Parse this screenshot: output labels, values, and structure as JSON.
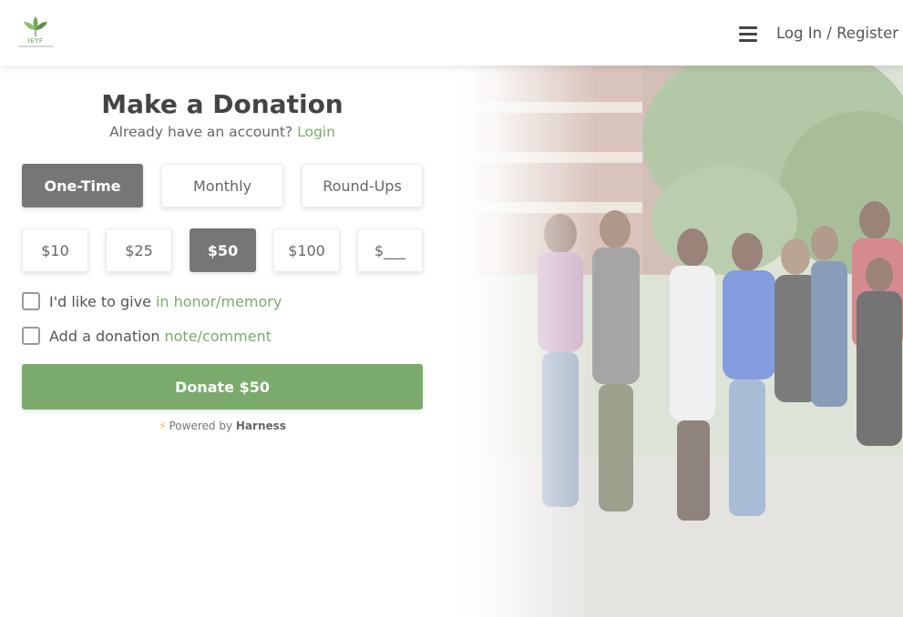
{
  "header": {
    "logo_text": "IEYF",
    "menu_icon": "hamburger-icon",
    "login_register": "Log In / Register"
  },
  "donation": {
    "title": "Make a Donation",
    "account_prompt": "Already have an account?",
    "login_link": "Login",
    "frequency": [
      {
        "label": "One-Time",
        "selected": true
      },
      {
        "label": "Monthly",
        "selected": false
      },
      {
        "label": "Round-Ups",
        "selected": false
      }
    ],
    "amounts": [
      {
        "label": "$10",
        "selected": false
      },
      {
        "label": "$25",
        "selected": false
      },
      {
        "label": "$50",
        "selected": true
      },
      {
        "label": "$100",
        "selected": false
      },
      {
        "label": "$___",
        "selected": false
      }
    ],
    "honor": {
      "prefix": "I'd like to give",
      "link": "in honor/memory",
      "checked": false
    },
    "note": {
      "prefix": "Add a donation",
      "link": "note/comment",
      "checked": false
    },
    "donate_button": "Donate $50",
    "powered_by_prefix": "Powered by",
    "powered_by_brand": "Harness"
  },
  "colors": {
    "accent_green": "#7aab6c",
    "selected_gray": "#767676",
    "bolt_yellow": "#e8b83a"
  }
}
